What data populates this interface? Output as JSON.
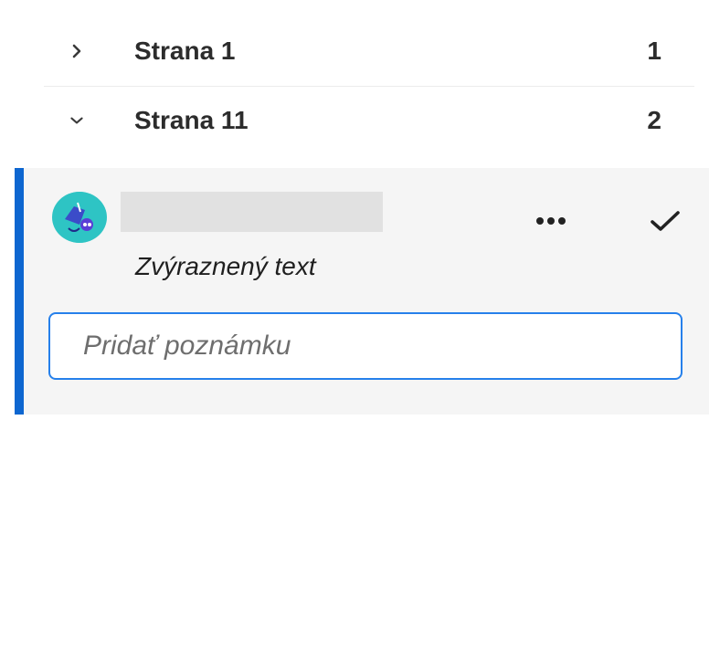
{
  "sections": [
    {
      "title": "Strana 1",
      "count": "1",
      "expanded": false,
      "chevron_icon": "chevron-right-icon"
    },
    {
      "title": "Strana 11",
      "count": "2",
      "expanded": true,
      "chevron_icon": "chevron-down-icon"
    }
  ],
  "comment": {
    "type_label": "Zvýraznený text",
    "more_icon": "more-horizontal-icon",
    "resolve_icon": "checkmark-icon",
    "avatar_icon": "user-avatar",
    "note_input": {
      "placeholder": "Pridať poznámku",
      "value": ""
    },
    "accent_color": "#0d66d0"
  }
}
